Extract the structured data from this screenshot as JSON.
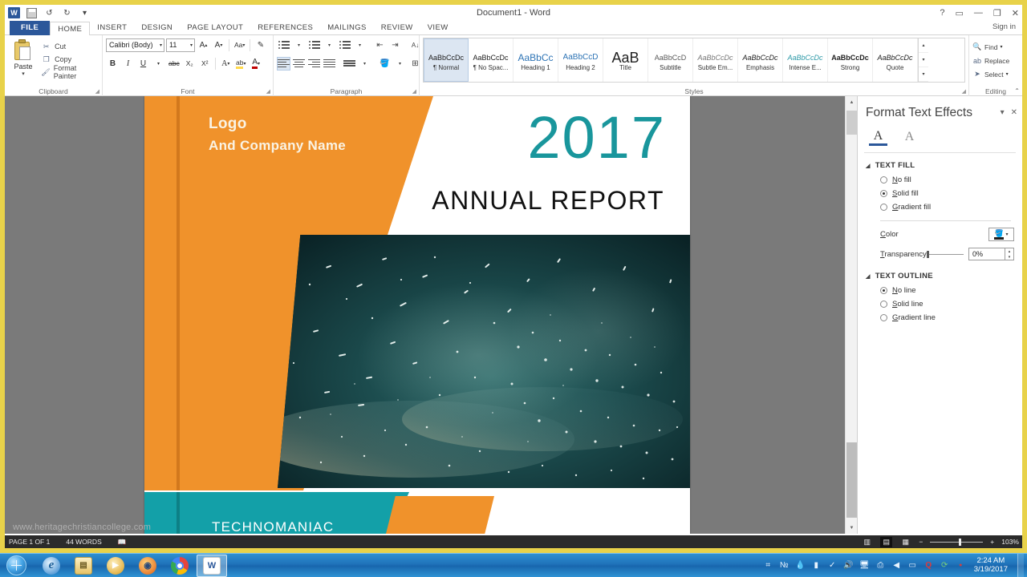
{
  "window": {
    "title": "Document1 - Word",
    "signin": "Sign in",
    "help_icon": "?",
    "ribbon_display_icon": "▭",
    "minimize_icon": "—",
    "restore_icon": "❐",
    "close_icon": "✕"
  },
  "quick_access": {
    "app_logo": "W",
    "save_icon": "save-icon",
    "undo_icon": "↺",
    "redo_icon": "↻",
    "customize_icon": "▾"
  },
  "tabs": [
    {
      "label": "FILE",
      "active": false,
      "file": true
    },
    {
      "label": "HOME",
      "active": true
    },
    {
      "label": "INSERT",
      "active": false
    },
    {
      "label": "DESIGN",
      "active": false
    },
    {
      "label": "PAGE LAYOUT",
      "active": false
    },
    {
      "label": "REFERENCES",
      "active": false
    },
    {
      "label": "MAILINGS",
      "active": false
    },
    {
      "label": "REVIEW",
      "active": false
    },
    {
      "label": "VIEW",
      "active": false
    }
  ],
  "ribbon": {
    "clipboard": {
      "group_label": "Clipboard",
      "paste_label": "Paste",
      "paste_arrow": "▾",
      "cut_label": "Cut",
      "copy_label": "Copy",
      "format_painter_label": "Format Painter"
    },
    "font": {
      "group_label": "Font",
      "font_name": "Calibri (Body)",
      "font_size": "11",
      "grow_font": "A",
      "shrink_font": "A",
      "change_case": "Aa",
      "clear_formatting": "✎",
      "bold": "B",
      "italic": "I",
      "underline": "U",
      "strikethrough": "abc",
      "subscript": "X₂",
      "superscript": "X²",
      "text_effects": "A",
      "highlight": "ab",
      "font_color": "A"
    },
    "paragraph": {
      "group_label": "Paragraph",
      "bullets": "bullets-icon",
      "numbering": "numbering-icon",
      "multilevel": "multilevel-list-icon",
      "decrease_indent": "⇤",
      "increase_indent": "⇥",
      "sort": "A↓",
      "show_marks": "¶",
      "align_left": "align-left-icon",
      "align_center": "align-center-icon",
      "align_right": "align-right-icon",
      "justify": "justify-icon",
      "line_spacing": "line-spacing-icon",
      "shading": "shading-icon",
      "borders": "borders-icon"
    },
    "styles": {
      "group_label": "Styles",
      "items": [
        {
          "preview": "AaBbCcDc",
          "name": "¶ Normal",
          "selected": true
        },
        {
          "preview": "AaBbCcDc",
          "name": "¶ No Spac...",
          "selected": false
        },
        {
          "preview": "AaBbCc",
          "name": "Heading 1",
          "selected": false
        },
        {
          "preview": "AaBbCcD",
          "name": "Heading 2",
          "selected": false
        },
        {
          "preview": "AaB",
          "name": "Title",
          "selected": false
        },
        {
          "preview": "AaBbCcD",
          "name": "Subtitle",
          "selected": false
        },
        {
          "preview": "AaBbCcDc",
          "name": "Subtle Em...",
          "selected": false
        },
        {
          "preview": "AaBbCcDc",
          "name": "Emphasis",
          "selected": false
        },
        {
          "preview": "AaBbCcDc",
          "name": "Intense E...",
          "selected": false
        },
        {
          "preview": "AaBbCcDc",
          "name": "Strong",
          "selected": false
        },
        {
          "preview": "AaBbCcDc",
          "name": "Quote",
          "selected": false
        }
      ],
      "scroll_up": "▴",
      "scroll_down": "▾",
      "more": "▾"
    },
    "editing": {
      "group_label": "Editing",
      "find_label": "Find",
      "find_arrow": "▾",
      "replace_label": "Replace",
      "select_label": "Select",
      "select_arrow": "▾"
    },
    "collapse_icon": "⌃"
  },
  "document": {
    "cover": {
      "logo_line1": "Logo",
      "logo_line2": "And Company Name",
      "year": "2017",
      "heading": "ANNUAL REPORT",
      "footer_brand": "TECHNOMANIAC",
      "photo_alt": "starfield-galaxy-photo"
    },
    "watermark": "www.heritagechristiancollege.com"
  },
  "pane": {
    "title": "Format Text Effects",
    "dropdown_icon": "▾",
    "close_icon": "✕",
    "tab_text_fill_icon": "A",
    "tab_text_box_icon": "A",
    "text_fill": {
      "section_label": "TEXT FILL",
      "options": [
        {
          "label": "No fill",
          "selected": false
        },
        {
          "label": "Solid fill",
          "selected": true
        },
        {
          "label": "Gradient fill",
          "selected": false
        }
      ],
      "color_label": "Color",
      "transparency_label": "Transparency",
      "transparency_value": "0%"
    },
    "text_outline": {
      "section_label": "TEXT OUTLINE",
      "options": [
        {
          "label": "No line",
          "selected": true
        },
        {
          "label": "Solid line",
          "selected": false
        },
        {
          "label": "Gradient line",
          "selected": false
        }
      ]
    }
  },
  "statusbar": {
    "page": "PAGE 1 OF 1",
    "words": "44 WORDS",
    "proofing_icon": "proofing-icon",
    "read_mode_icon": "read-mode-icon",
    "print_layout_icon": "print-layout-icon",
    "web_layout_icon": "web-layout-icon",
    "zoom_out": "−",
    "zoom_in": "+",
    "zoom_level": "103%"
  },
  "taskbar": {
    "start_label": "start-orb",
    "items": [
      {
        "name": "internet-explorer",
        "glyph": "e",
        "active": false
      },
      {
        "name": "windows-explorer",
        "glyph": "▤",
        "active": false
      },
      {
        "name": "windows-media-player",
        "glyph": "▶",
        "active": false
      },
      {
        "name": "firefox",
        "glyph": "◉",
        "active": false
      },
      {
        "name": "google-chrome",
        "glyph": "",
        "active": false
      },
      {
        "name": "microsoft-word",
        "glyph": "W",
        "active": true
      }
    ],
    "tray": [
      {
        "name": "hardware-icon",
        "glyph": "⌗"
      },
      {
        "name": "network-monitor-icon",
        "glyph": "№"
      },
      {
        "name": "water-drop-icon",
        "glyph": "💧"
      },
      {
        "name": "performance-icon",
        "glyph": "▮"
      },
      {
        "name": "antivirus-icon",
        "glyph": "✓"
      },
      {
        "name": "volume-icon",
        "glyph": "🔊"
      },
      {
        "name": "network-icon",
        "glyph": "🖥"
      },
      {
        "name": "driver-icon",
        "glyph": "⎙"
      },
      {
        "name": "speaker-icon",
        "glyph": "◀"
      },
      {
        "name": "display-icon",
        "glyph": "▭"
      },
      {
        "name": "quicktime-icon",
        "glyph": "Q"
      },
      {
        "name": "sync-icon",
        "glyph": "⟳"
      },
      {
        "name": "alert-icon",
        "glyph": "●"
      }
    ],
    "clock_time": "2:24 AM",
    "clock_date": "3/19/2017"
  }
}
